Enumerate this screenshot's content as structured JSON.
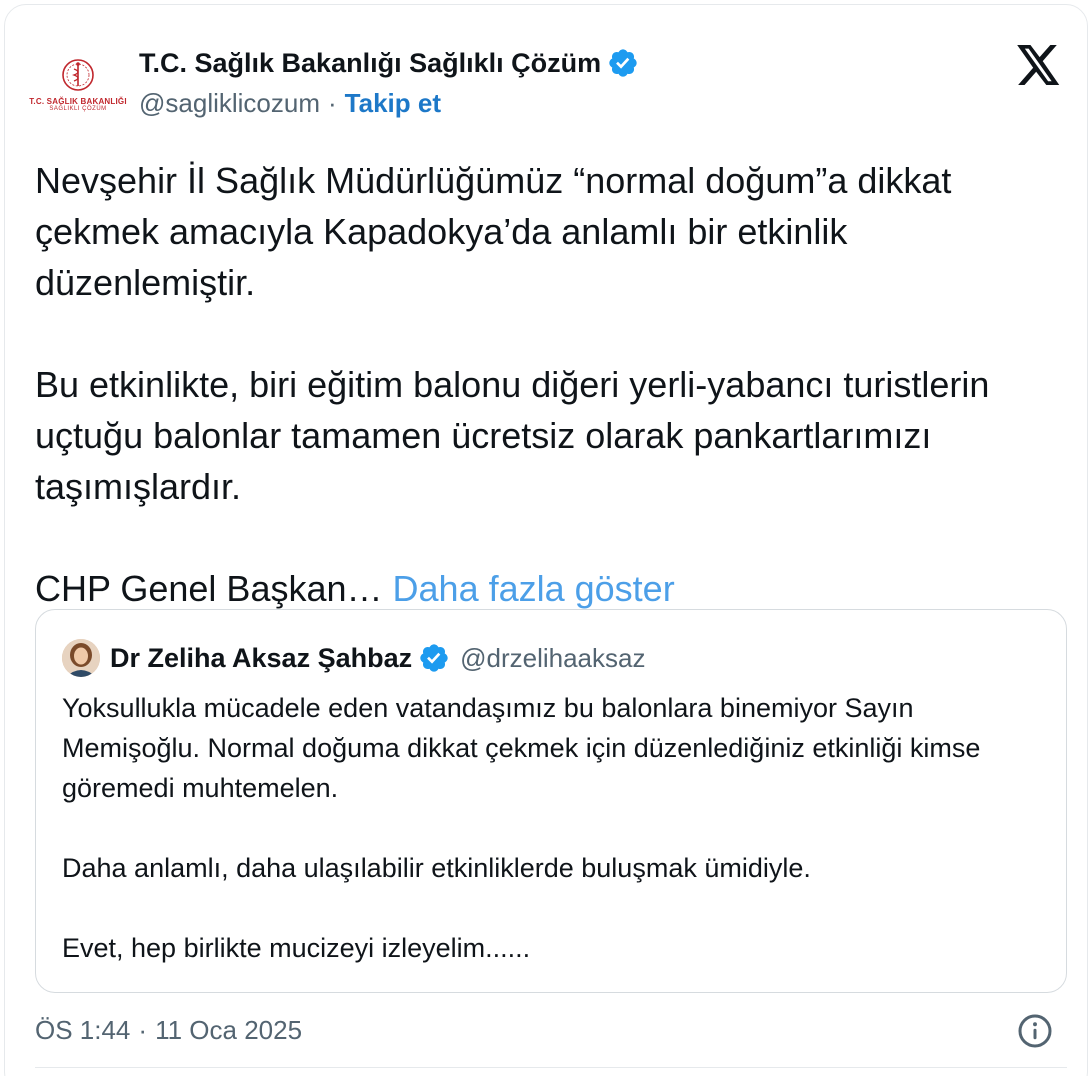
{
  "account": {
    "avatar_line1": "T.C. SAĞLIK BAKANLIĞI",
    "avatar_line2": "SAĞLIKLI ÇÖZÜM",
    "display_name": "T.C. Sağlık Bakanlığı Sağlıklı Çözüm",
    "handle": "@sagliklicozum",
    "separator": "·",
    "follow_label": "Takip et",
    "verified_icon": "verified-badge-icon",
    "brand_icon": "x-logo-icon"
  },
  "tweet": {
    "paragraph1": "Nevşehir İl Sağlık Müdürlüğümüz “normal doğum”a dikkat çekmek amacıyla Kapadokya’da anlamlı bir etkinlik düzenlemiştir.",
    "paragraph2": "Bu etkinlikte, biri eğitim balonu diğeri yerli-yabancı turistlerin uçtuğu balonlar tamamen ücretsiz olarak pankartlarımızı taşımışlardır.",
    "paragraph3": "CHP Genel Başkan…",
    "show_more_label": "Daha fazla göster"
  },
  "quote": {
    "display_name": "Dr Zeliha Aksaz Şahbaz",
    "handle": "@drzelihaaksaz",
    "paragraph1": "Yoksullukla mücadele eden vatandaşımız bu balonlara binemiyor Sayın Memişoğlu. Normal doğuma dikkat çekmek için düzenlediğiniz etkinliği kimse göremedi muhtemelen.",
    "paragraph2": "Daha anlamlı, daha ulaşılabilir etkinliklerde buluşmak ümidiyle.",
    "paragraph3": "Evet, hep birlikte mucizeyi izleyelim......"
  },
  "footer": {
    "time": "ÖS 1:44",
    "separator": "·",
    "date": "11 Oca 2025",
    "info_icon": "info-icon"
  },
  "colors": {
    "link": "#1d78c8",
    "show_more": "#4c9fe8",
    "verified": "#1d9bf0",
    "muted": "#536471",
    "brand_red": "#c0272d"
  }
}
